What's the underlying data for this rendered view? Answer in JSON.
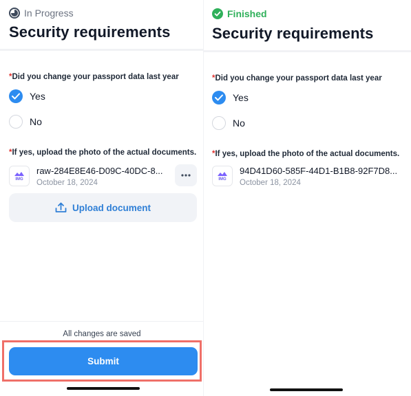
{
  "left": {
    "status": "In Progress",
    "title": "Security requirements",
    "question1": "Did you change your passport data last year",
    "options": [
      {
        "label": "Yes",
        "selected": true
      },
      {
        "label": "No",
        "selected": false
      }
    ],
    "question2": "If yes, upload the photo of the actual documents.",
    "file": {
      "icon_label": "IMG",
      "name": "raw-284E8E46-D09C-40DC-8...",
      "date": "October 18, 2024"
    },
    "upload_label": "Upload document",
    "saved_text": "All changes are saved",
    "submit_label": "Submit"
  },
  "right": {
    "status": "Finished",
    "title": "Security requirements",
    "question1": "Did you change your passport data last year",
    "options": [
      {
        "label": "Yes",
        "selected": true
      },
      {
        "label": "No",
        "selected": false
      }
    ],
    "question2": "If yes, upload the photo of the actual documents.",
    "file": {
      "icon_label": "IMG",
      "name": "94D41D60-585F-44D1-B1B8-92F7D8...",
      "date": "October 18, 2024"
    }
  },
  "required_mark": "*",
  "colors": {
    "accent": "#2d8cf0",
    "finished": "#2fb05a",
    "required": "#e0322f",
    "highlight": "#ef6f68"
  }
}
